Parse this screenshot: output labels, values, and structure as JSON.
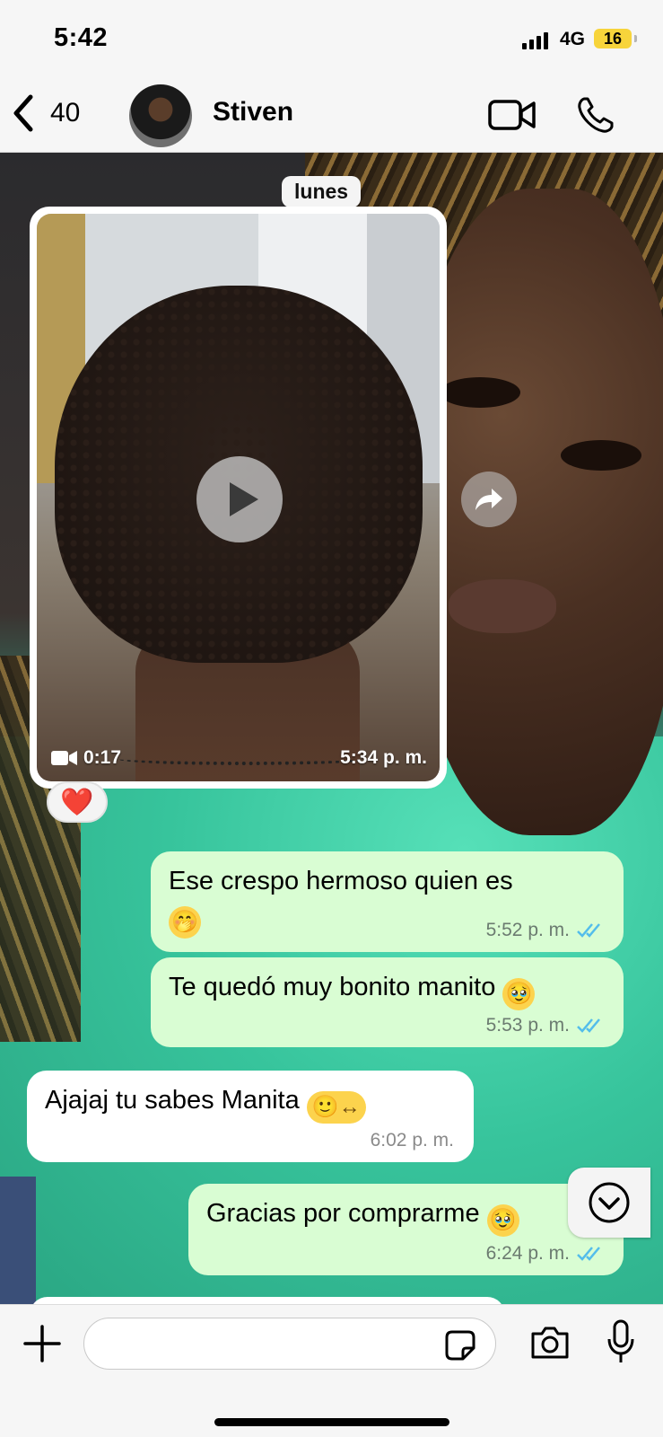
{
  "status_bar": {
    "time": "5:42",
    "network": "4G",
    "battery": "16"
  },
  "header": {
    "unread_count": "40",
    "contact_name": "Stiven",
    "icons": [
      "back-chevron-icon",
      "video-camera-icon",
      "phone-icon"
    ]
  },
  "date_chip": "lunes",
  "video_message": {
    "duration": "0:17",
    "time": "5:34 p. m.",
    "reaction": "❤️"
  },
  "messages": [
    {
      "direction": "out",
      "text": "Ese crespo hermoso quien es",
      "emoji": "🤭",
      "time": "5:52 p. m.",
      "status": "read"
    },
    {
      "direction": "out",
      "text": "Te quedó muy bonito manito",
      "emoji": "🥹",
      "time": "5:53 p. m.",
      "status": "read"
    },
    {
      "direction": "in",
      "text": "Ajajaj tu sabes Manita",
      "emoji": "🙂↔",
      "time": "6:02 p. m."
    },
    {
      "direction": "out",
      "text": "Gracias por comprarme",
      "emoji": "🥹",
      "time": "6:24 p. m.",
      "status": "read"
    }
  ],
  "composer": {
    "placeholder": "",
    "value": ""
  },
  "colors": {
    "outgoing_bubble": "#d9fdd3",
    "incoming_bubble": "#ffffff",
    "read_ticks": "#53bdeb",
    "reaction_heart": "#e8203a"
  }
}
